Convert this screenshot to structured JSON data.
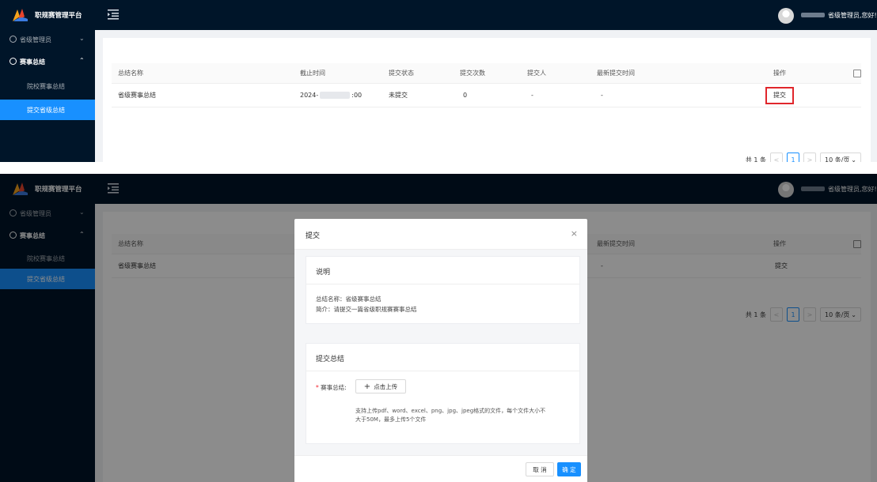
{
  "app": {
    "title": "职规赛管理平台",
    "user_suffix": "省级管理员,您好!"
  },
  "sidebar": {
    "groups": [
      {
        "label": "省级管理员",
        "chevron": "⌄"
      },
      {
        "label": "赛事总结",
        "chevron": "⌃"
      }
    ],
    "items": [
      {
        "label": "院校赛事总结"
      },
      {
        "label": "提交省级总结"
      }
    ]
  },
  "table": {
    "columns": [
      "总结名称",
      "截止时间",
      "提交状态",
      "提交次数",
      "提交人",
      "最新提交时间",
      "操作"
    ],
    "rows": [
      {
        "name": "省级赛事总结",
        "deadline_start": "2024-",
        "deadline_end": ":00",
        "status": "未提交",
        "count": "0",
        "submitter": "-",
        "latest": "-",
        "action": "提交"
      }
    ]
  },
  "pager": {
    "total": "共 1 条",
    "prev": "<",
    "page": "1",
    "next": ">",
    "size": "10 条/页",
    "size_chevron": "⌄"
  },
  "modal": {
    "title": "提交",
    "close": "×",
    "desc_header": "说明",
    "desc_name": "总结名称：省级赛事总结",
    "desc_intro": "简介：请提交一篇省级职规赛赛事总结",
    "submit_header": "提交总结",
    "field_required": "*",
    "field_label": "赛事总结:",
    "upload_plus": "+",
    "upload_label": "点击上传",
    "hint_line1": "支持上传pdf、word、excel、png、jpg、jpeg格式的文件，每个文件大小不",
    "hint_line2": "大于50M，最多上传5个文件",
    "cancel": "取 消",
    "ok": "确 定"
  },
  "colors": {
    "nav_bg": "#001529",
    "accent": "#1890ff",
    "highlight": "#e0262b"
  }
}
